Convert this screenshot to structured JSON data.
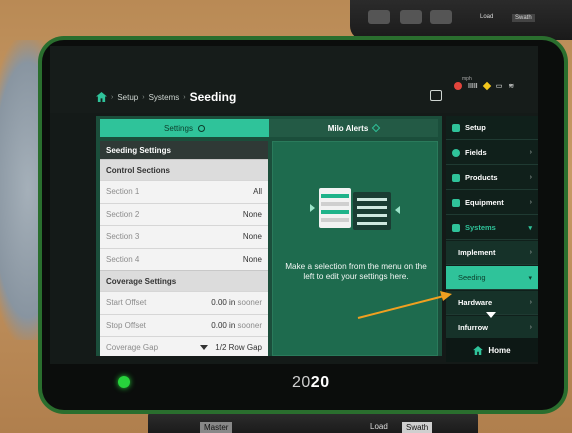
{
  "breadcrumb": {
    "items": [
      "Setup",
      "Systems"
    ],
    "current": "Seeding"
  },
  "status_bar": {
    "unit_label": "mph",
    "signal": "IIIII"
  },
  "tabs": [
    {
      "label": "Settings",
      "active": true
    },
    {
      "label": "Milo Alerts",
      "active": false
    }
  ],
  "settings": {
    "title": "Seeding Settings",
    "control_sections": {
      "heading": "Control Sections",
      "rows": [
        {
          "label": "Section 1",
          "value": "All"
        },
        {
          "label": "Section 2",
          "value": "None"
        },
        {
          "label": "Section 3",
          "value": "None"
        },
        {
          "label": "Section 4",
          "value": "None"
        }
      ]
    },
    "coverage_settings": {
      "heading": "Coverage Settings",
      "rows": [
        {
          "label": "Start Offset",
          "value": "0.00 in",
          "suffix": "sooner"
        },
        {
          "label": "Stop Offset",
          "value": "0.00 in",
          "suffix": "sooner"
        },
        {
          "label": "Coverage Gap",
          "value": "1/2 Row Gap"
        }
      ]
    }
  },
  "panel": {
    "message": "Make a selection from the menu on the left to edit your settings here."
  },
  "sidebar": {
    "items": [
      {
        "label": "Setup",
        "icon": "setup-icon"
      },
      {
        "label": "Fields",
        "icon": "fields-icon"
      },
      {
        "label": "Products",
        "icon": "products-icon"
      },
      {
        "label": "Equipment",
        "icon": "equipment-icon"
      },
      {
        "label": "Systems",
        "icon": "systems-icon"
      },
      {
        "label": "Implement"
      },
      {
        "label": "Seeding"
      },
      {
        "label": "Hardware"
      },
      {
        "label": "Infurrow"
      }
    ],
    "home_label": "Home"
  },
  "brand": {
    "left": "20",
    "right": "20"
  },
  "bottom_device": {
    "labels": [
      "Master",
      "Load",
      "Swath"
    ]
  },
  "top_device": {
    "labels": [
      "Load",
      "Swath"
    ]
  },
  "colors": {
    "accent": "#2fc39a",
    "panel": "#1e6b4e",
    "bezel": "#2a6e2e",
    "arrow": "#f0a020"
  }
}
